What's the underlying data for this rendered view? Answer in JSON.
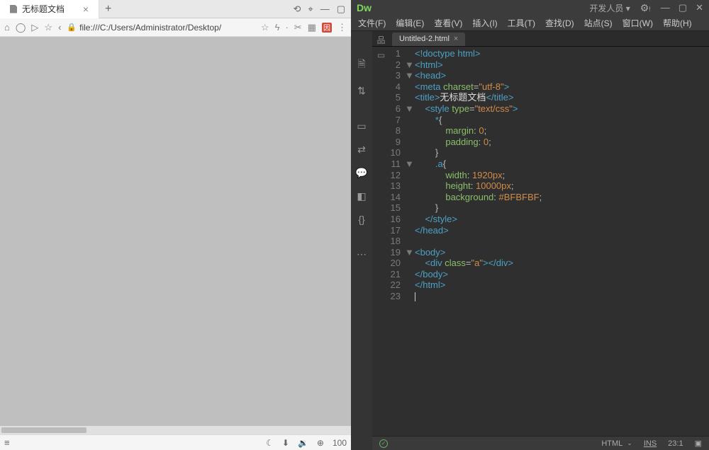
{
  "browser": {
    "tab_title": "无标题文档",
    "url": "file:///C:/Users/Administrator/Desktop/",
    "new_tab": "+",
    "close": "×",
    "zoom": "100"
  },
  "dw": {
    "logo": "Dw",
    "workspace_label": "开发人员",
    "menu": {
      "file": "文件(F)",
      "edit": "编辑(E)",
      "view": "查看(V)",
      "insert": "插入(I)",
      "tools": "工具(T)",
      "find": "查找(D)",
      "site": "站点(S)",
      "window": "窗口(W)",
      "help": "帮助(H)"
    },
    "file_tab": "Untitled-2.html",
    "file_tab_close": "×",
    "status": {
      "lang": "HTML",
      "ins": "INS",
      "pos": "23:1"
    },
    "code": {
      "l1": "<!doctype html>",
      "l2": {
        "open": "<",
        "tag": "html",
        "close": ">"
      },
      "l3": {
        "open": "<",
        "tag": "head",
        "close": ">"
      },
      "l4": {
        "open": "<",
        "tag": "meta",
        "sp": " ",
        "attr": "charset",
        "eq": "=",
        "val": "\"utf-8\"",
        "close": ">"
      },
      "l5": {
        "open": "<",
        "tag": "title",
        "close1": ">",
        "text": "无标题文档",
        "open2": "</",
        "tag2": "title",
        "close2": ">"
      },
      "l6": {
        "indent": "    ",
        "open": "<",
        "tag": "style",
        "sp": " ",
        "attr": "type",
        "eq": "=",
        "val": "\"text/css\"",
        "close": ">"
      },
      "l7": {
        "indent": "        ",
        "sel": "*",
        "brace": "{"
      },
      "l8": {
        "indent": "            ",
        "prop": "margin",
        "colon": ": ",
        "val": "0",
        "semi": ";"
      },
      "l9": {
        "indent": "            ",
        "prop": "padding",
        "colon": ": ",
        "val": "0",
        "semi": ";"
      },
      "l10": {
        "indent": "        ",
        "brace": "}"
      },
      "l11": {
        "indent": "        ",
        "sel": ".a",
        "brace": "{"
      },
      "l12": {
        "indent": "            ",
        "prop": "width",
        "colon": ": ",
        "val": "1920px",
        "semi": ";"
      },
      "l13": {
        "indent": "            ",
        "prop": "height",
        "colon": ": ",
        "val": "10000px",
        "semi": ";"
      },
      "l14": {
        "indent": "            ",
        "prop": "background",
        "colon": ": ",
        "val": "#BFBFBF",
        "semi": ";"
      },
      "l15": {
        "indent": "        ",
        "brace": "}"
      },
      "l16": {
        "indent": "    ",
        "open": "</",
        "tag": "style",
        "close": ">"
      },
      "l17": {
        "open": "</",
        "tag": "head",
        "close": ">"
      },
      "l18": "",
      "l19": {
        "open": "<",
        "tag": "body",
        "close": ">"
      },
      "l20": {
        "indent": "    ",
        "open": "<",
        "tag": "div",
        "sp": " ",
        "attr": "class",
        "eq": "=",
        "val": "\"a\"",
        "close1": ">",
        "open2": "</",
        "tag2": "div",
        "close2": ">"
      },
      "l21": {
        "open": "</",
        "tag": "body",
        "close": ">"
      },
      "l22": {
        "open": "</",
        "tag": "html",
        "close": ">"
      }
    },
    "line_numbers": [
      "1",
      "2",
      "3",
      "4",
      "5",
      "6",
      "7",
      "8",
      "9",
      "10",
      "11",
      "12",
      "13",
      "14",
      "15",
      "16",
      "17",
      "18",
      "19",
      "20",
      "21",
      "22",
      "23"
    ],
    "fold_markers": {
      "2": "▼",
      "3": "▼",
      "6": "▼",
      "11": "▼",
      "19": "▼"
    }
  }
}
